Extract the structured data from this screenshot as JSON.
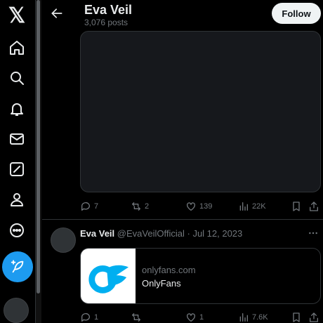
{
  "nav": {
    "logo": "𝕏",
    "items": [
      {
        "icon": "home-icon"
      },
      {
        "icon": "search-icon"
      },
      {
        "icon": "bell-icon"
      },
      {
        "icon": "mail-icon"
      },
      {
        "icon": "grok-icon"
      },
      {
        "icon": "person-icon"
      },
      {
        "icon": "more-circle-icon"
      }
    ],
    "post_button_icon": "feather-plus-icon"
  },
  "header": {
    "title": "Eva Veil",
    "post_count": "3,076 posts",
    "follow_label": "Follow"
  },
  "post1": {
    "media": "photo",
    "stats": {
      "replies": "7",
      "reposts": "2",
      "likes": "139",
      "views": "22K"
    }
  },
  "post2": {
    "display_name": "Eva Veil",
    "handle": "@EvaVeilOfficial",
    "separator": "·",
    "date": "Jul 12, 2023",
    "card": {
      "domain": "onlyfans.com",
      "title": "OnlyFans"
    },
    "stats": {
      "replies": "1",
      "reposts": "",
      "likes": "1",
      "views": "7.6K"
    }
  },
  "colors": {
    "background": "#000000",
    "accent": "#1d9bf0",
    "muted_text": "#71767b",
    "primary_text": "#e7e9ea",
    "divider": "#2f3336"
  }
}
